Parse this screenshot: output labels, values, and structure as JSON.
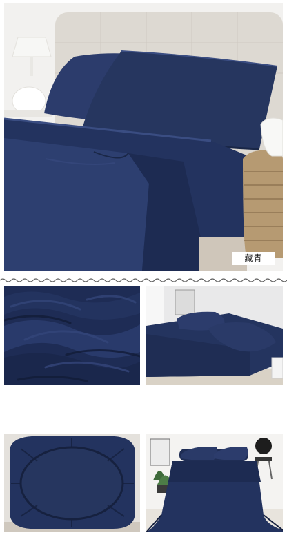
{
  "color_label": "藏青",
  "colors": {
    "navy": "#23335f",
    "navy_light": "#34467a",
    "navy_dark": "#16213f",
    "wall": "#f2f1ef",
    "headboard": "#ddd9d2"
  }
}
